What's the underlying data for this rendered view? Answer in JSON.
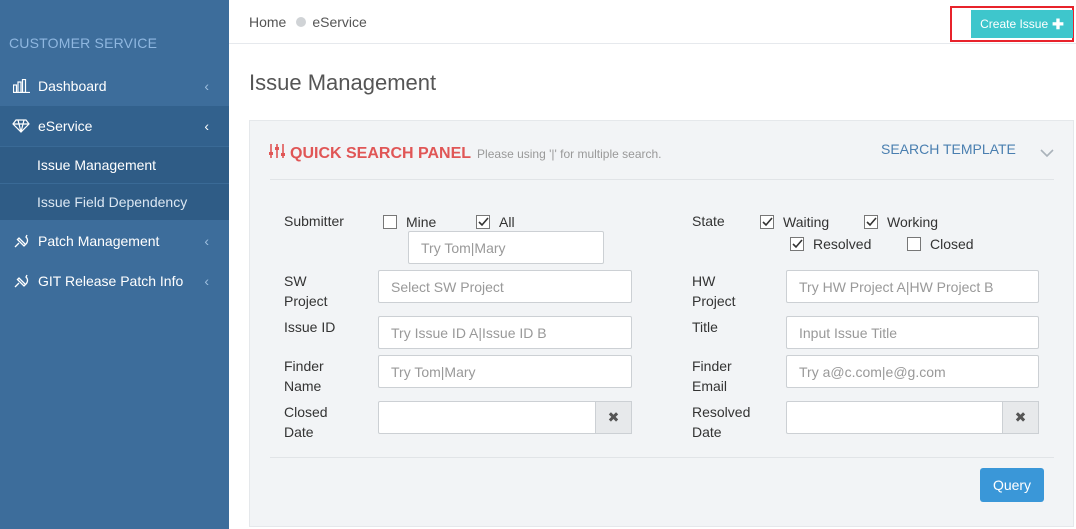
{
  "sidebar": {
    "brand": "CUSTOMER SERVICE",
    "items": [
      {
        "label": "Dashboard"
      },
      {
        "label": "eService"
      },
      {
        "label": "Patch Management"
      },
      {
        "label": "GIT Release Patch Info"
      }
    ],
    "subitems": [
      {
        "label": "Issue Management"
      },
      {
        "label": "Issue Field Dependency"
      }
    ]
  },
  "breadcrumb": {
    "home": "Home",
    "current": "eService"
  },
  "header": {
    "create_label": "Create Issue"
  },
  "page": {
    "title": "Issue Management"
  },
  "panel": {
    "title": "QUICK SEARCH PANEL",
    "hint": "Please using '|' for multiple search.",
    "template_label": "SEARCH TEMPLATE",
    "submitter": {
      "label": "Submitter",
      "mine": "Mine",
      "all": "All",
      "placeholder": "Try Tom|Mary"
    },
    "state": {
      "label": "State",
      "waiting": "Waiting",
      "working": "Working",
      "resolved": "Resolved",
      "closed": "Closed"
    },
    "sw_project": {
      "label_1": "SW",
      "label_2": "Project",
      "placeholder": "Select SW Project"
    },
    "hw_project": {
      "label_1": "HW",
      "label_2": "Project",
      "placeholder": "Try HW Project A|HW Project B"
    },
    "issue_id": {
      "label": "Issue ID",
      "placeholder": "Try Issue ID A|Issue ID B"
    },
    "title_field": {
      "label": "Title",
      "placeholder": "Input Issue Title"
    },
    "finder_name": {
      "label_1": "Finder",
      "label_2": "Name",
      "placeholder": "Try Tom|Mary"
    },
    "finder_email": {
      "label_1": "Finder",
      "label_2": "Email",
      "placeholder": "Try a@c.com|e@g.com"
    },
    "closed_date": {
      "label_1": "Closed",
      "label_2": "Date",
      "clear": "✖"
    },
    "resolved_date": {
      "label_1": "Resolved",
      "label_2": "Date",
      "clear": "✖"
    },
    "query_label": "Query"
  },
  "colors": {
    "sidebar": "#3d6d9b",
    "accent": "#3ec6cc",
    "panel_title": "#e05656",
    "query": "#3a97d8"
  },
  "icons": {
    "dashboard": "bar-chart-icon",
    "eservice": "diamond-icon",
    "patch": "plug-icon",
    "git": "plug-icon",
    "panel": "sliders-icon",
    "collapse": "chevron-down-icon"
  }
}
